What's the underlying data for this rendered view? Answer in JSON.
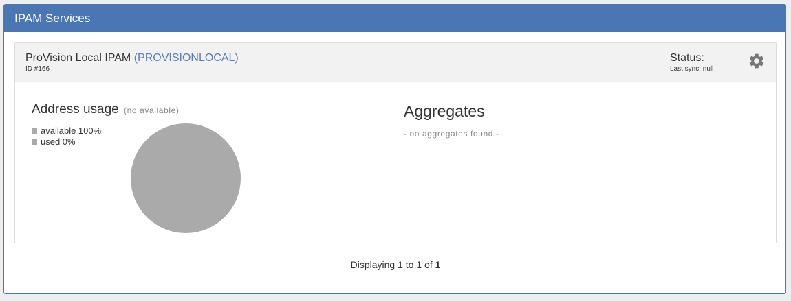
{
  "panel": {
    "title": "IPAM Services"
  },
  "service": {
    "name": "ProVision Local IPAM",
    "code": "(PROVISIONLOCAL)",
    "id": "ID #166",
    "status_label": "Status:",
    "last_sync": "Last sync: null",
    "settings_icon": "gear-icon"
  },
  "usage": {
    "title": "Address usage",
    "subtitle": "(no available)",
    "legend": [
      {
        "label": "available 100%",
        "color": "#aaaaaa"
      },
      {
        "label": "used 0%",
        "color": "#aaaaaa"
      }
    ],
    "pie_color": "#aaaaaa"
  },
  "chart_data": {
    "type": "pie",
    "categories": [
      "available",
      "used"
    ],
    "values": [
      100,
      0
    ]
  },
  "aggregates": {
    "title": "Aggregates",
    "empty_message": "- no aggregates found -"
  },
  "footer": {
    "prefix": "Displaying ",
    "from": "1",
    "to_word": " to ",
    "to": "1",
    "of_word": " of ",
    "total": "1"
  }
}
